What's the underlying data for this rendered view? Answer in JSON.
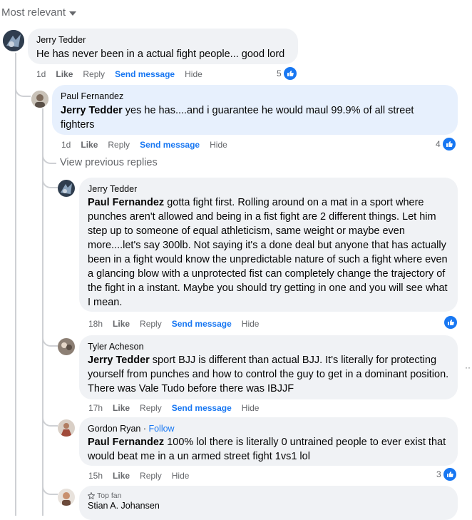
{
  "sort": {
    "label": "Most relevant"
  },
  "comments": [
    {
      "author": "Jerry Tedder",
      "text": "He has never been in a actual fight people... good lord",
      "time": "1d",
      "like": "Like",
      "reply": "Reply",
      "send": "Send message",
      "hide": "Hide",
      "reactions": "5"
    },
    {
      "author": "Paul Fernandez",
      "mention": "Jerry Tedder",
      "text": " yes he has....and i guarantee he would maul 99.9% of all street fighters",
      "time": "1d",
      "like": "Like",
      "reply": "Reply",
      "send": "Send message",
      "hide": "Hide",
      "reactions": "4"
    },
    {
      "author": "Jerry Tedder",
      "mention": "Paul Fernandez",
      "text": " gotta fight first. Rolling around on a mat in a sport where punches aren't allowed and being in a fist fight are 2 different things. Let him step up to someone of equal athleticism, same weight or maybe even more....let's say 300lb. Not saying it's a done deal but anyone that has actually been in a fight would know the unpredictable nature of such a fight where even a glancing blow with a unprotected fist can completely change the trajectory of the fight in a instant. Maybe you should try getting in one and you will see what I mean.",
      "time": "18h",
      "like": "Like",
      "reply": "Reply",
      "send": "Send message",
      "hide": "Hide"
    },
    {
      "author": "Tyler Acheson",
      "mention": "Jerry Tedder",
      "text": " sport BJJ is different than actual BJJ. It's literally for protecting yourself from punches and how to control the guy to get in a dominant position. There was Vale Tudo before there was IBJJF",
      "time": "17h",
      "like": "Like",
      "reply": "Reply",
      "send": "Send message",
      "hide": "Hide"
    },
    {
      "author": "Gordon Ryan",
      "follow": "Follow",
      "mention": "Paul Fernandez",
      "text": " 100% lol there is literally 0 untrained people to ever exist that would beat me in a un armed street fight 1vs1 lol",
      "time": "15h",
      "like": "Like",
      "reply": "Reply",
      "hide": "Hide",
      "reactions": "3"
    },
    {
      "badge": "Top fan",
      "author": "Stian A. Johansen"
    }
  ],
  "view_previous": "View previous replies",
  "colors": {
    "accent": "#1877f2",
    "bubble": "#f0f2f5",
    "highlight": "#e7f0fd",
    "muted": "#65676b"
  }
}
